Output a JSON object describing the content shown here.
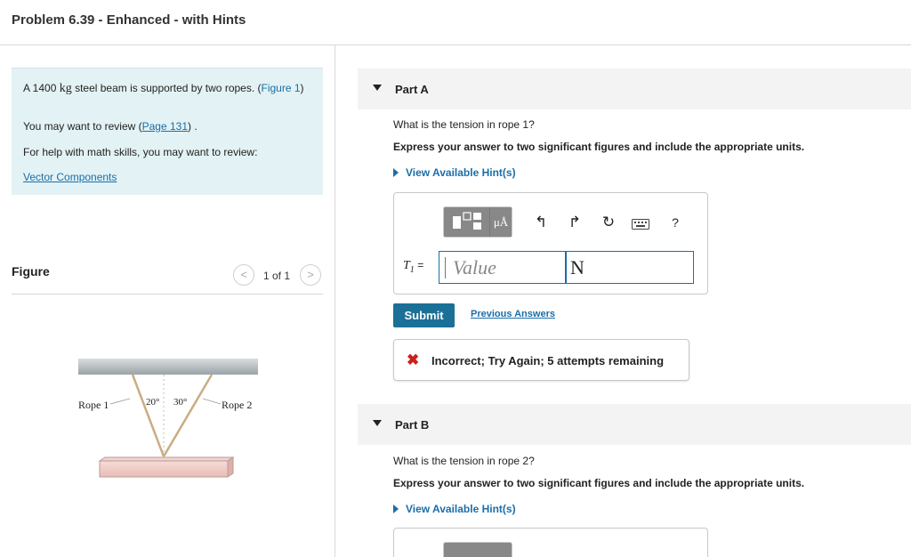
{
  "header": {
    "title": "Problem 6.39 - Enhanced - with Hints"
  },
  "intro": {
    "line_prefix": "A 1400",
    "mass_unit": "kg",
    "line_suffix": "steel beam is supported by two ropes. (",
    "figure_link": "Figure 1",
    "line_close": ")",
    "review_prefix": "You may want to review (",
    "review_link": "Page 131",
    "review_suffix": ") .",
    "math_help": "For help with math skills, you may want to review:",
    "vector_link": "Vector Components"
  },
  "figure": {
    "label": "Figure",
    "pager_prev": "<",
    "pager_count": "1 of 1",
    "pager_next": ">",
    "rope1_label": "Rope 1",
    "rope2_label": "Rope 2",
    "angle1": "20°",
    "angle2": "30°"
  },
  "part_a": {
    "title": "Part A",
    "question": "What is the tension in rope 1?",
    "instruction": "Express your answer to two significant figures and include the appropriate units.",
    "hint_label": "View Available Hint(s)",
    "toolbar": {
      "units_label": "μÅ",
      "undo_icon": "↰",
      "redo_icon": "↱",
      "reset_icon": "↻",
      "help_label": "?"
    },
    "variable": "T",
    "variable_sub": "1",
    "equals": "=",
    "value_placeholder": "Value",
    "unit_value": "N",
    "submit_label": "Submit",
    "previous_answers": "Previous Answers",
    "feedback_icon": "✖",
    "feedback": "Incorrect; Try Again; 5 attempts remaining"
  },
  "part_b": {
    "title": "Part B",
    "question": "What is the tension in rope 2?",
    "instruction": "Express your answer to two significant figures and include the appropriate units.",
    "hint_label": "View Available Hint(s)"
  }
}
